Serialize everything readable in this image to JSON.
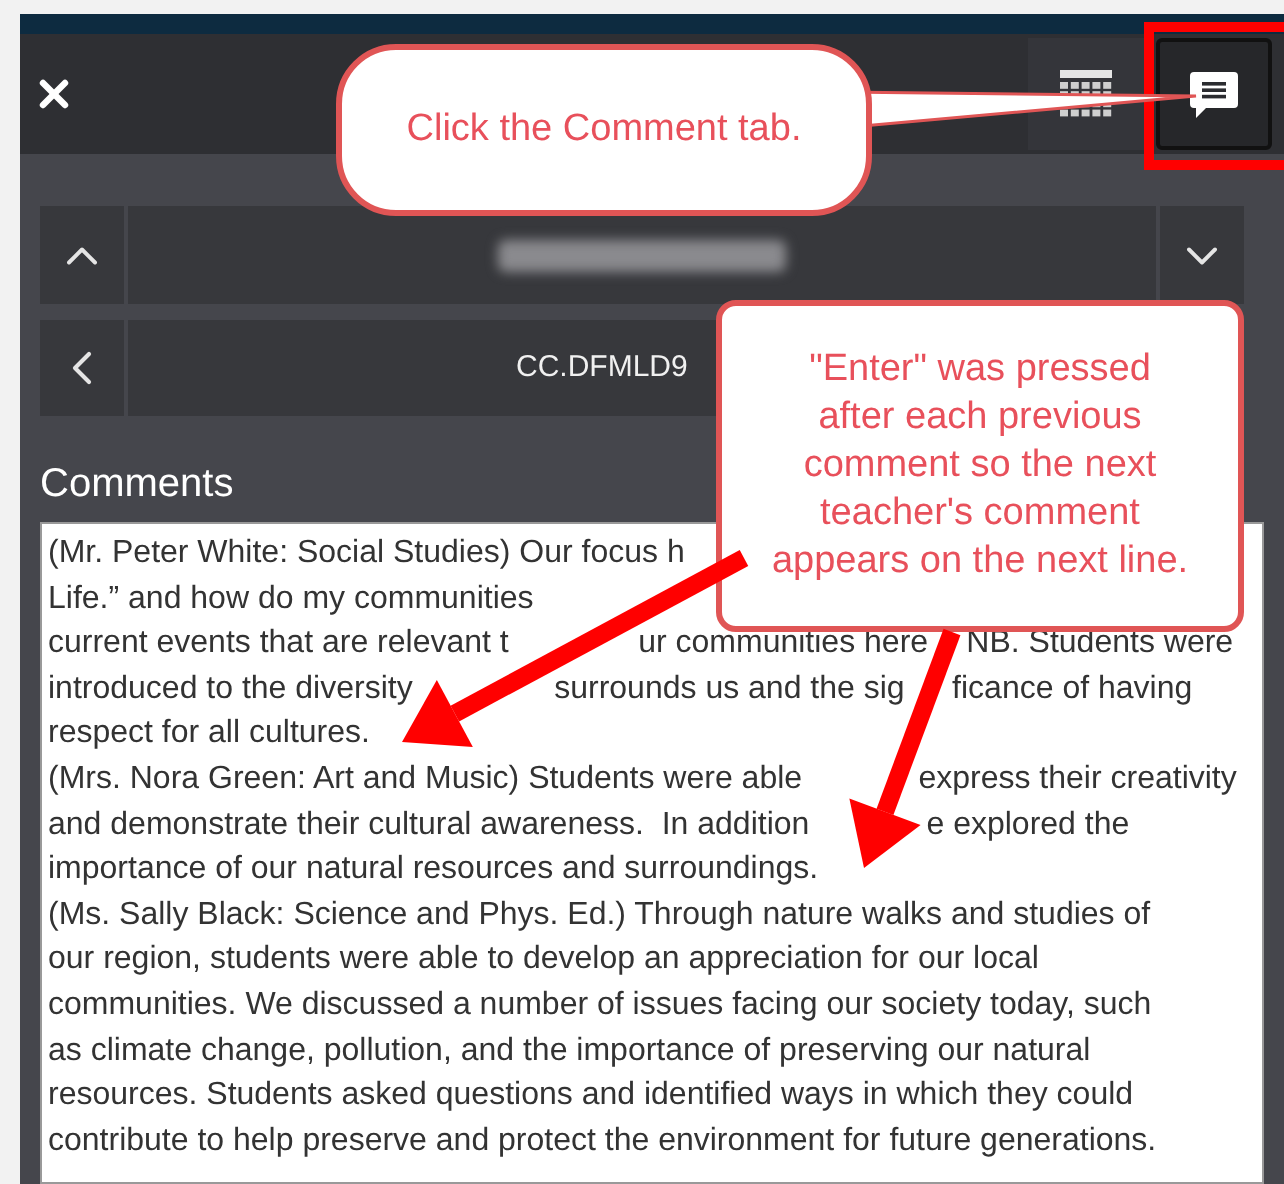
{
  "header": {
    "tabs": [
      {
        "kind": "grid",
        "selected": false
      },
      {
        "kind": "comment",
        "selected": true,
        "annotated": true
      }
    ]
  },
  "student_row": {
    "name_blurred": true
  },
  "course_row": {
    "code": "CC.DFMLD9"
  },
  "comments": {
    "label": "Comments",
    "lines": [
      [
        "(Mr. Peter White: Social Studies) Our focus h"
      ],
      [
        "Life.” and how do my communities"
      ],
      [
        "current events that are relevant t",
        "ur communities here",
        "NB. Students were"
      ],
      [
        "introduced to the diversity",
        "surrounds us and the sig",
        "ficance of having"
      ],
      [
        "respect for all cultures."
      ],
      [
        "(Mrs. Nora Green: Art and Music) Students were able",
        "express their creativity"
      ],
      [
        "and demonstrate their cultural awareness.  In addition",
        "e explored the"
      ],
      [
        "importance of our natural resources and surroundings."
      ],
      [
        "(Ms. Sally Black: Science and Phys. Ed.) Through nature walks and studies of"
      ],
      [
        "our region, students were able to develop an appreciation for our local"
      ],
      [
        "communities. We discussed a number of issues facing our society today, such"
      ],
      [
        "as climate change, pollution, and the importance of preserving our natural"
      ],
      [
        "resources. Students asked questions and identified ways in which they could"
      ],
      [
        "contribute to help preserve and protect the environment for future generations."
      ]
    ]
  },
  "callouts": [
    {
      "lines": [
        "Click the Comment tab."
      ]
    },
    {
      "lines": [
        "\"Enter\" was pressed",
        "after each previous",
        "comment so the next",
        "teacher's comment",
        "appears on the next line."
      ]
    }
  ]
}
